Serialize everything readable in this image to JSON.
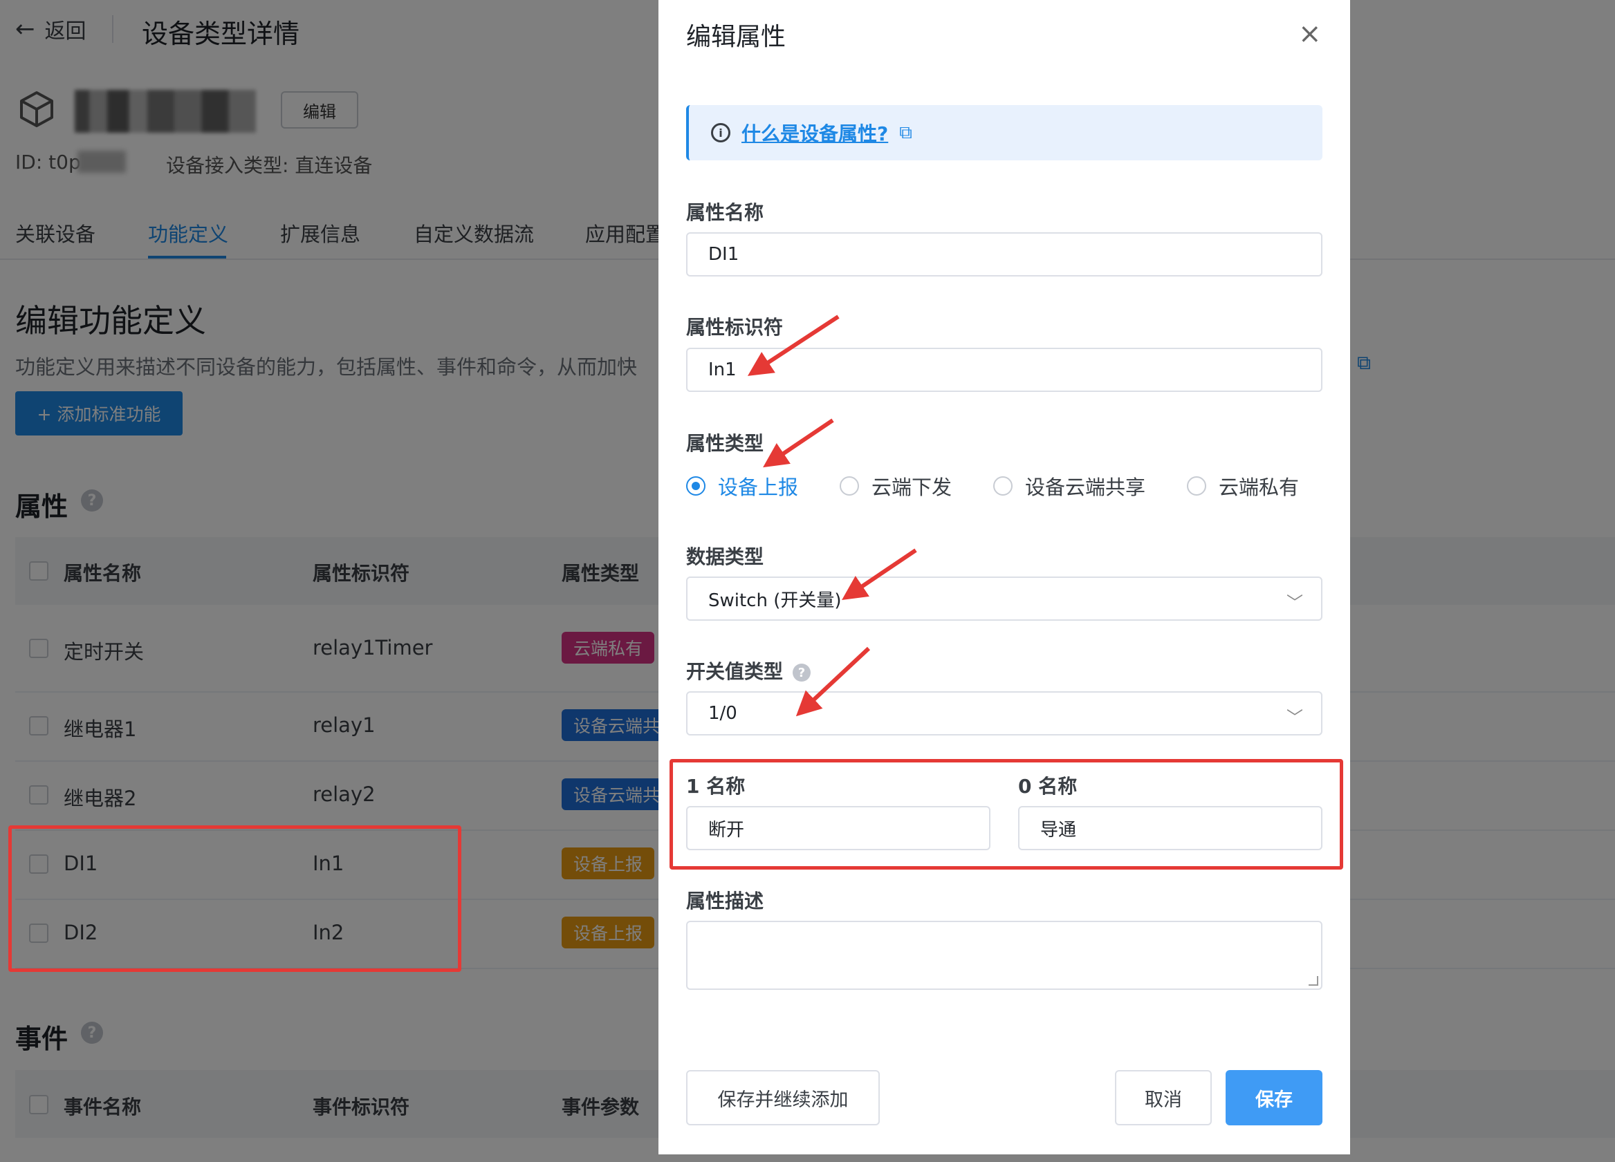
{
  "header": {
    "back_label": "返回",
    "title": "设备类型详情",
    "edit_label": "编辑",
    "device_id": "ID: t0p",
    "access_type": "设备接入类型: 直连设备"
  },
  "tabs": [
    {
      "label": "关联设备"
    },
    {
      "label": "功能定义"
    },
    {
      "label": "扩展信息"
    },
    {
      "label": "自定义数据流"
    },
    {
      "label": "应用配置"
    }
  ],
  "function_def": {
    "heading": "编辑功能定义",
    "description": "功能定义用来描述不同设备的能力，包括属性、事件和命令，从而加快",
    "add_button": "+ 添加标准功能"
  },
  "properties": {
    "heading": "属性",
    "columns": [
      "属性名称",
      "属性标识符",
      "属性类型"
    ],
    "rows": [
      {
        "name": "定时开关",
        "id": "relay1Timer",
        "type": "云端私有"
      },
      {
        "name": "继电器1",
        "id": "relay1",
        "type": "设备云端共"
      },
      {
        "name": "继电器2",
        "id": "relay2",
        "type": "设备云端共"
      },
      {
        "name": "DI1",
        "id": "In1",
        "type": "设备上报"
      },
      {
        "name": "DI2",
        "id": "In2",
        "type": "设备上报"
      }
    ]
  },
  "events": {
    "heading": "事件",
    "columns": [
      "事件名称",
      "事件标识符",
      "事件参数"
    ]
  },
  "drawer": {
    "title": "编辑属性",
    "close_icon": "×",
    "info_link": "什么是设备属性?",
    "fields": {
      "name_label": "属性名称",
      "name_value": "DI1",
      "identifier_label": "属性标识符",
      "identifier_value": "In1",
      "type_label": "属性类型",
      "type_options": [
        "设备上报",
        "云端下发",
        "设备云端共享",
        "云端私有"
      ],
      "type_selected": "设备上报",
      "data_type_label": "数据类型",
      "data_type_value": "Switch (开关量)",
      "switch_type_label": "开关值类型",
      "switch_type_value": "1/0",
      "one_name_label": "1 名称",
      "one_name_value": "断开",
      "zero_name_label": "0 名称",
      "zero_name_value": "导通",
      "desc_label": "属性描述"
    },
    "buttons": {
      "save_continue": "保存并继续添加",
      "cancel": "取消",
      "save": "保存"
    }
  },
  "colors": {
    "primary": "#1e88e5",
    "annotation": "#e53935",
    "badge_private": "#d63384",
    "badge_shared": "#1e6fd9",
    "badge_report": "#e89a12"
  }
}
